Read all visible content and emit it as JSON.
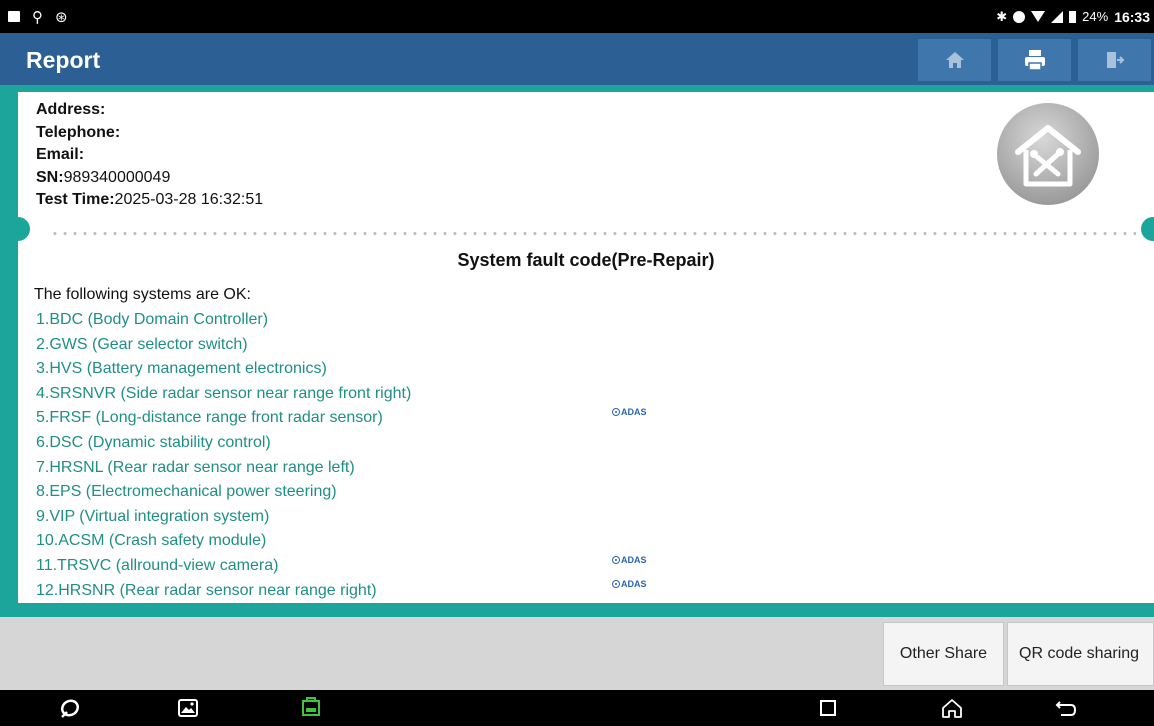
{
  "status_bar": {
    "time": "16:33",
    "battery": "24%"
  },
  "header": {
    "title": "Report"
  },
  "report": {
    "address_label": "Address:",
    "telephone_label": "Telephone:",
    "email_label": "Email:",
    "sn_label": "SN:",
    "sn_value": "989340000049",
    "test_time_label": "Test Time:",
    "test_time_value": "2025-03-28 16:32:51",
    "section_title": "System fault code(Pre-Repair)",
    "ok_label": "The following systems are OK:",
    "systems": [
      "1.BDC (Body Domain Controller)",
      "2.GWS (Gear selector switch)",
      "3.HVS (Battery management electronics)",
      "4.SRSNVR (Side radar sensor near range front right)",
      "5.FRSF (Long-distance range front radar sensor)",
      "6.DSC (Dynamic stability control)",
      "7.HRSNL (Rear radar sensor near range left)",
      "8.EPS (Electromechanical power steering)",
      "9.VIP (Virtual integration system)",
      "10.ACSM (Crash safety module)",
      "11.TRSVC (allround-view camera)",
      "12.HRSNR (Rear radar sensor near range right)"
    ],
    "adas_label": "ADAS"
  },
  "actions": {
    "other_share": "Other Share",
    "qr_share": "QR code sharing"
  },
  "colors": {
    "header_bg": "#2c5f93",
    "teal": "#1ba59b",
    "system_text": "#1f8f86",
    "adas": "#2a66b0"
  },
  "icons": [
    "home-icon",
    "print-icon",
    "exit-icon",
    "report-logo-icon",
    "vci-icon",
    "browser-icon",
    "gallery-icon",
    "recents-icon",
    "home-nav-icon",
    "back-icon"
  ]
}
